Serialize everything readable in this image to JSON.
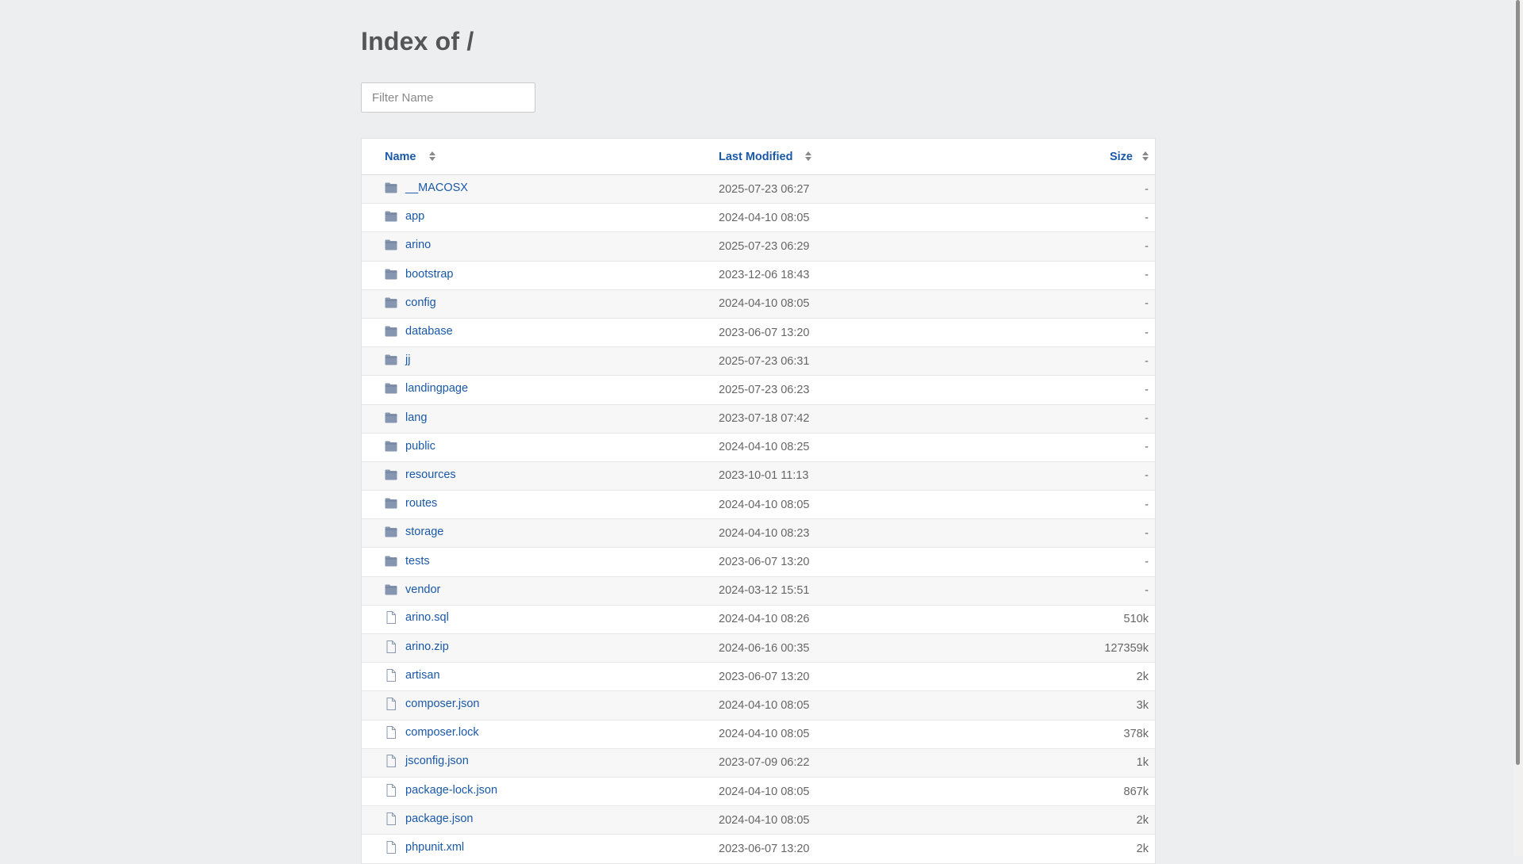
{
  "page": {
    "title": "Index of /"
  },
  "filter": {
    "placeholder": "Filter Name",
    "value": ""
  },
  "headers": {
    "name": "Name",
    "modified": "Last Modified",
    "size": "Size"
  },
  "colors": {
    "link": "#1a58a8",
    "folder_icon": "#7a8ba8",
    "file_icon": "#8a98b0"
  },
  "entries": [
    {
      "name": "__MACOSX",
      "modified": "2025-07-23 06:27",
      "size": "-",
      "icon": "folder-icon"
    },
    {
      "name": "app",
      "modified": "2024-04-10 08:05",
      "size": "-",
      "icon": "folder-icon"
    },
    {
      "name": "arino",
      "modified": "2025-07-23 06:29",
      "size": "-",
      "icon": "folder-icon"
    },
    {
      "name": "bootstrap",
      "modified": "2023-12-06 18:43",
      "size": "-",
      "icon": "folder-icon"
    },
    {
      "name": "config",
      "modified": "2024-04-10 08:05",
      "size": "-",
      "icon": "folder-icon"
    },
    {
      "name": "database",
      "modified": "2023-06-07 13:20",
      "size": "-",
      "icon": "folder-icon"
    },
    {
      "name": "jj",
      "modified": "2025-07-23 06:31",
      "size": "-",
      "icon": "folder-icon"
    },
    {
      "name": "landingpage",
      "modified": "2025-07-23 06:23",
      "size": "-",
      "icon": "folder-icon"
    },
    {
      "name": "lang",
      "modified": "2023-07-18 07:42",
      "size": "-",
      "icon": "folder-icon"
    },
    {
      "name": "public",
      "modified": "2024-04-10 08:25",
      "size": "-",
      "icon": "folder-icon"
    },
    {
      "name": "resources",
      "modified": "2023-10-01 11:13",
      "size": "-",
      "icon": "folder-icon"
    },
    {
      "name": "routes",
      "modified": "2024-04-10 08:05",
      "size": "-",
      "icon": "folder-icon"
    },
    {
      "name": "storage",
      "modified": "2024-04-10 08:23",
      "size": "-",
      "icon": "folder-icon"
    },
    {
      "name": "tests",
      "modified": "2023-06-07 13:20",
      "size": "-",
      "icon": "folder-icon"
    },
    {
      "name": "vendor",
      "modified": "2024-03-12 15:51",
      "size": "-",
      "icon": "folder-icon"
    },
    {
      "name": "arino.sql",
      "modified": "2024-04-10 08:26",
      "size": "510k",
      "icon": "file-icon"
    },
    {
      "name": "arino.zip",
      "modified": "2024-06-16 00:35",
      "size": "127359k",
      "icon": "file-icon"
    },
    {
      "name": "artisan",
      "modified": "2023-06-07 13:20",
      "size": "2k",
      "icon": "file-icon"
    },
    {
      "name": "composer.json",
      "modified": "2024-04-10 08:05",
      "size": "3k",
      "icon": "file-icon"
    },
    {
      "name": "composer.lock",
      "modified": "2024-04-10 08:05",
      "size": "378k",
      "icon": "file-icon"
    },
    {
      "name": "jsconfig.json",
      "modified": "2023-07-09 06:22",
      "size": "1k",
      "icon": "file-icon"
    },
    {
      "name": "package-lock.json",
      "modified": "2024-04-10 08:05",
      "size": "867k",
      "icon": "file-icon"
    },
    {
      "name": "package.json",
      "modified": "2024-04-10 08:05",
      "size": "2k",
      "icon": "file-icon"
    },
    {
      "name": "phpunit.xml",
      "modified": "2023-06-07 13:20",
      "size": "2k",
      "icon": "file-icon"
    }
  ]
}
